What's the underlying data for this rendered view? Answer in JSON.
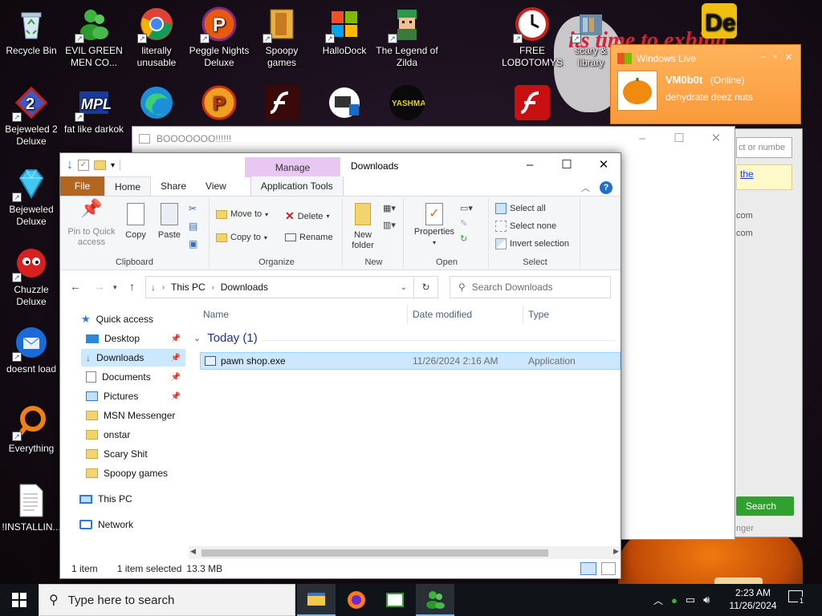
{
  "desktop": {
    "icons": [
      {
        "label": "Recycle Bin",
        "icon": "recycle-bin-icon"
      },
      {
        "label": "EVIL GREEN MEN CO...",
        "icon": "msn-people-icon"
      },
      {
        "label": "literally unusable",
        "icon": "chrome-icon"
      },
      {
        "label": "Peggle Nights Deluxe",
        "icon": "peggle-icon"
      },
      {
        "label": "Spoopy games",
        "icon": "folder-icon"
      },
      {
        "label": "HalloDock",
        "icon": "windows-shield-icon"
      },
      {
        "label": "The Legend of Zilda",
        "icon": "zelda-icon"
      },
      {
        "label": "FREE LOBOTOMYS",
        "icon": "clock-icon"
      },
      {
        "label": "scary & library",
        "icon": "library-icon"
      },
      {
        "label": "Bejeweled 2 Deluxe",
        "icon": "bejeweled2-icon"
      },
      {
        "label": "fat like darkok",
        "icon": "mpl-icon"
      },
      {
        "label": "Bejeweled Deluxe",
        "icon": "diamond-icon"
      },
      {
        "label": "Chuzzle Deluxe",
        "icon": "chuzzle-icon"
      },
      {
        "label": "doesnt load",
        "icon": "thunderbird-icon"
      },
      {
        "label": "Everything",
        "icon": "search-ring-icon"
      },
      {
        "label": "!INSTALLIN...",
        "icon": "text-file-icon"
      }
    ],
    "banner_text": "its time to exhibit"
  },
  "msn": {
    "title": "Windows Live",
    "user": "VM0b0t",
    "status": "(Online)",
    "message": "dehydrate deez nuts",
    "search_placeholder": "ct or numbe",
    "link": "the",
    "emails": [
      "com",
      "com"
    ],
    "search_button": "Search",
    "footer": "nger"
  },
  "bgdialog": {
    "title": "BOOOOOOO!!!!!!"
  },
  "explorer": {
    "title": "Downloads",
    "context_tab": "Manage",
    "tabs": {
      "file": "File",
      "home": "Home",
      "share": "Share",
      "view": "View",
      "app_tools": "Application Tools"
    },
    "ribbon": {
      "clipboard": {
        "label": "Clipboard",
        "pin": "Pin to Quick access",
        "copy": "Copy",
        "paste": "Paste"
      },
      "organize": {
        "label": "Organize",
        "move_to": "Move to",
        "copy_to": "Copy to",
        "delete": "Delete",
        "rename": "Rename"
      },
      "new": {
        "label": "New",
        "new_folder": "New folder"
      },
      "open": {
        "label": "Open",
        "properties": "Properties"
      },
      "select": {
        "label": "Select",
        "select_all": "Select all",
        "select_none": "Select none",
        "invert": "Invert selection"
      }
    },
    "address": {
      "segments": [
        "This PC",
        "Downloads"
      ],
      "search_placeholder": "Search Downloads"
    },
    "nav": {
      "quick_access": "Quick access",
      "items": [
        {
          "label": "Desktop",
          "pinned": true
        },
        {
          "label": "Downloads",
          "pinned": true,
          "selected": true
        },
        {
          "label": "Documents",
          "pinned": true
        },
        {
          "label": "Pictures",
          "pinned": true
        },
        {
          "label": "MSN Messenger",
          "pinned": false
        },
        {
          "label": "onstar",
          "pinned": false
        },
        {
          "label": "Scary Shit",
          "pinned": false
        },
        {
          "label": "Spoopy games",
          "pinned": false
        }
      ],
      "this_pc": "This PC",
      "network": "Network"
    },
    "columns": [
      "Name",
      "Date modified",
      "Type"
    ],
    "group": "Today (1)",
    "files": [
      {
        "name": "pawn shop.exe",
        "date": "11/26/2024 2:16 AM",
        "type": "Application"
      }
    ],
    "status": {
      "count": "1 item",
      "selected": "1 item selected",
      "size": "13.3 MB"
    }
  },
  "taskbar": {
    "search_placeholder": "Type here to search",
    "time": "2:23 AM",
    "date": "11/26/2024",
    "notification_count": "1"
  }
}
